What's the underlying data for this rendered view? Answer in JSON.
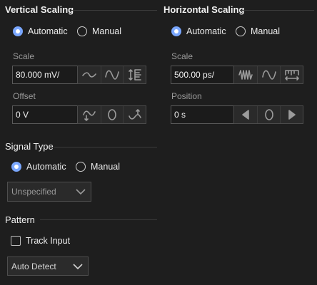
{
  "vertical_scaling": {
    "title": "Vertical Scaling",
    "mode_automatic": "Automatic",
    "mode_manual": "Manual",
    "selected": "Automatic",
    "scale_label": "Scale",
    "scale_value": "80.000 mV/",
    "offset_label": "Offset",
    "offset_value": "0 V"
  },
  "horizontal_scaling": {
    "title": "Horizontal Scaling",
    "mode_automatic": "Automatic",
    "mode_manual": "Manual",
    "selected": "Automatic",
    "scale_label": "Scale",
    "scale_value": "500.00 ps/",
    "position_label": "Position",
    "position_value": "0 s"
  },
  "signal_type": {
    "title": "Signal Type",
    "mode_automatic": "Automatic",
    "mode_manual": "Manual",
    "selected": "Automatic",
    "dropdown_value": "Unspecified"
  },
  "pattern": {
    "title": "Pattern",
    "track_input_label": "Track Input",
    "track_input_checked": false,
    "dropdown_value": "Auto Detect"
  },
  "colors": {
    "background": "#1e1e1e",
    "accent": "#7aa7ff"
  }
}
